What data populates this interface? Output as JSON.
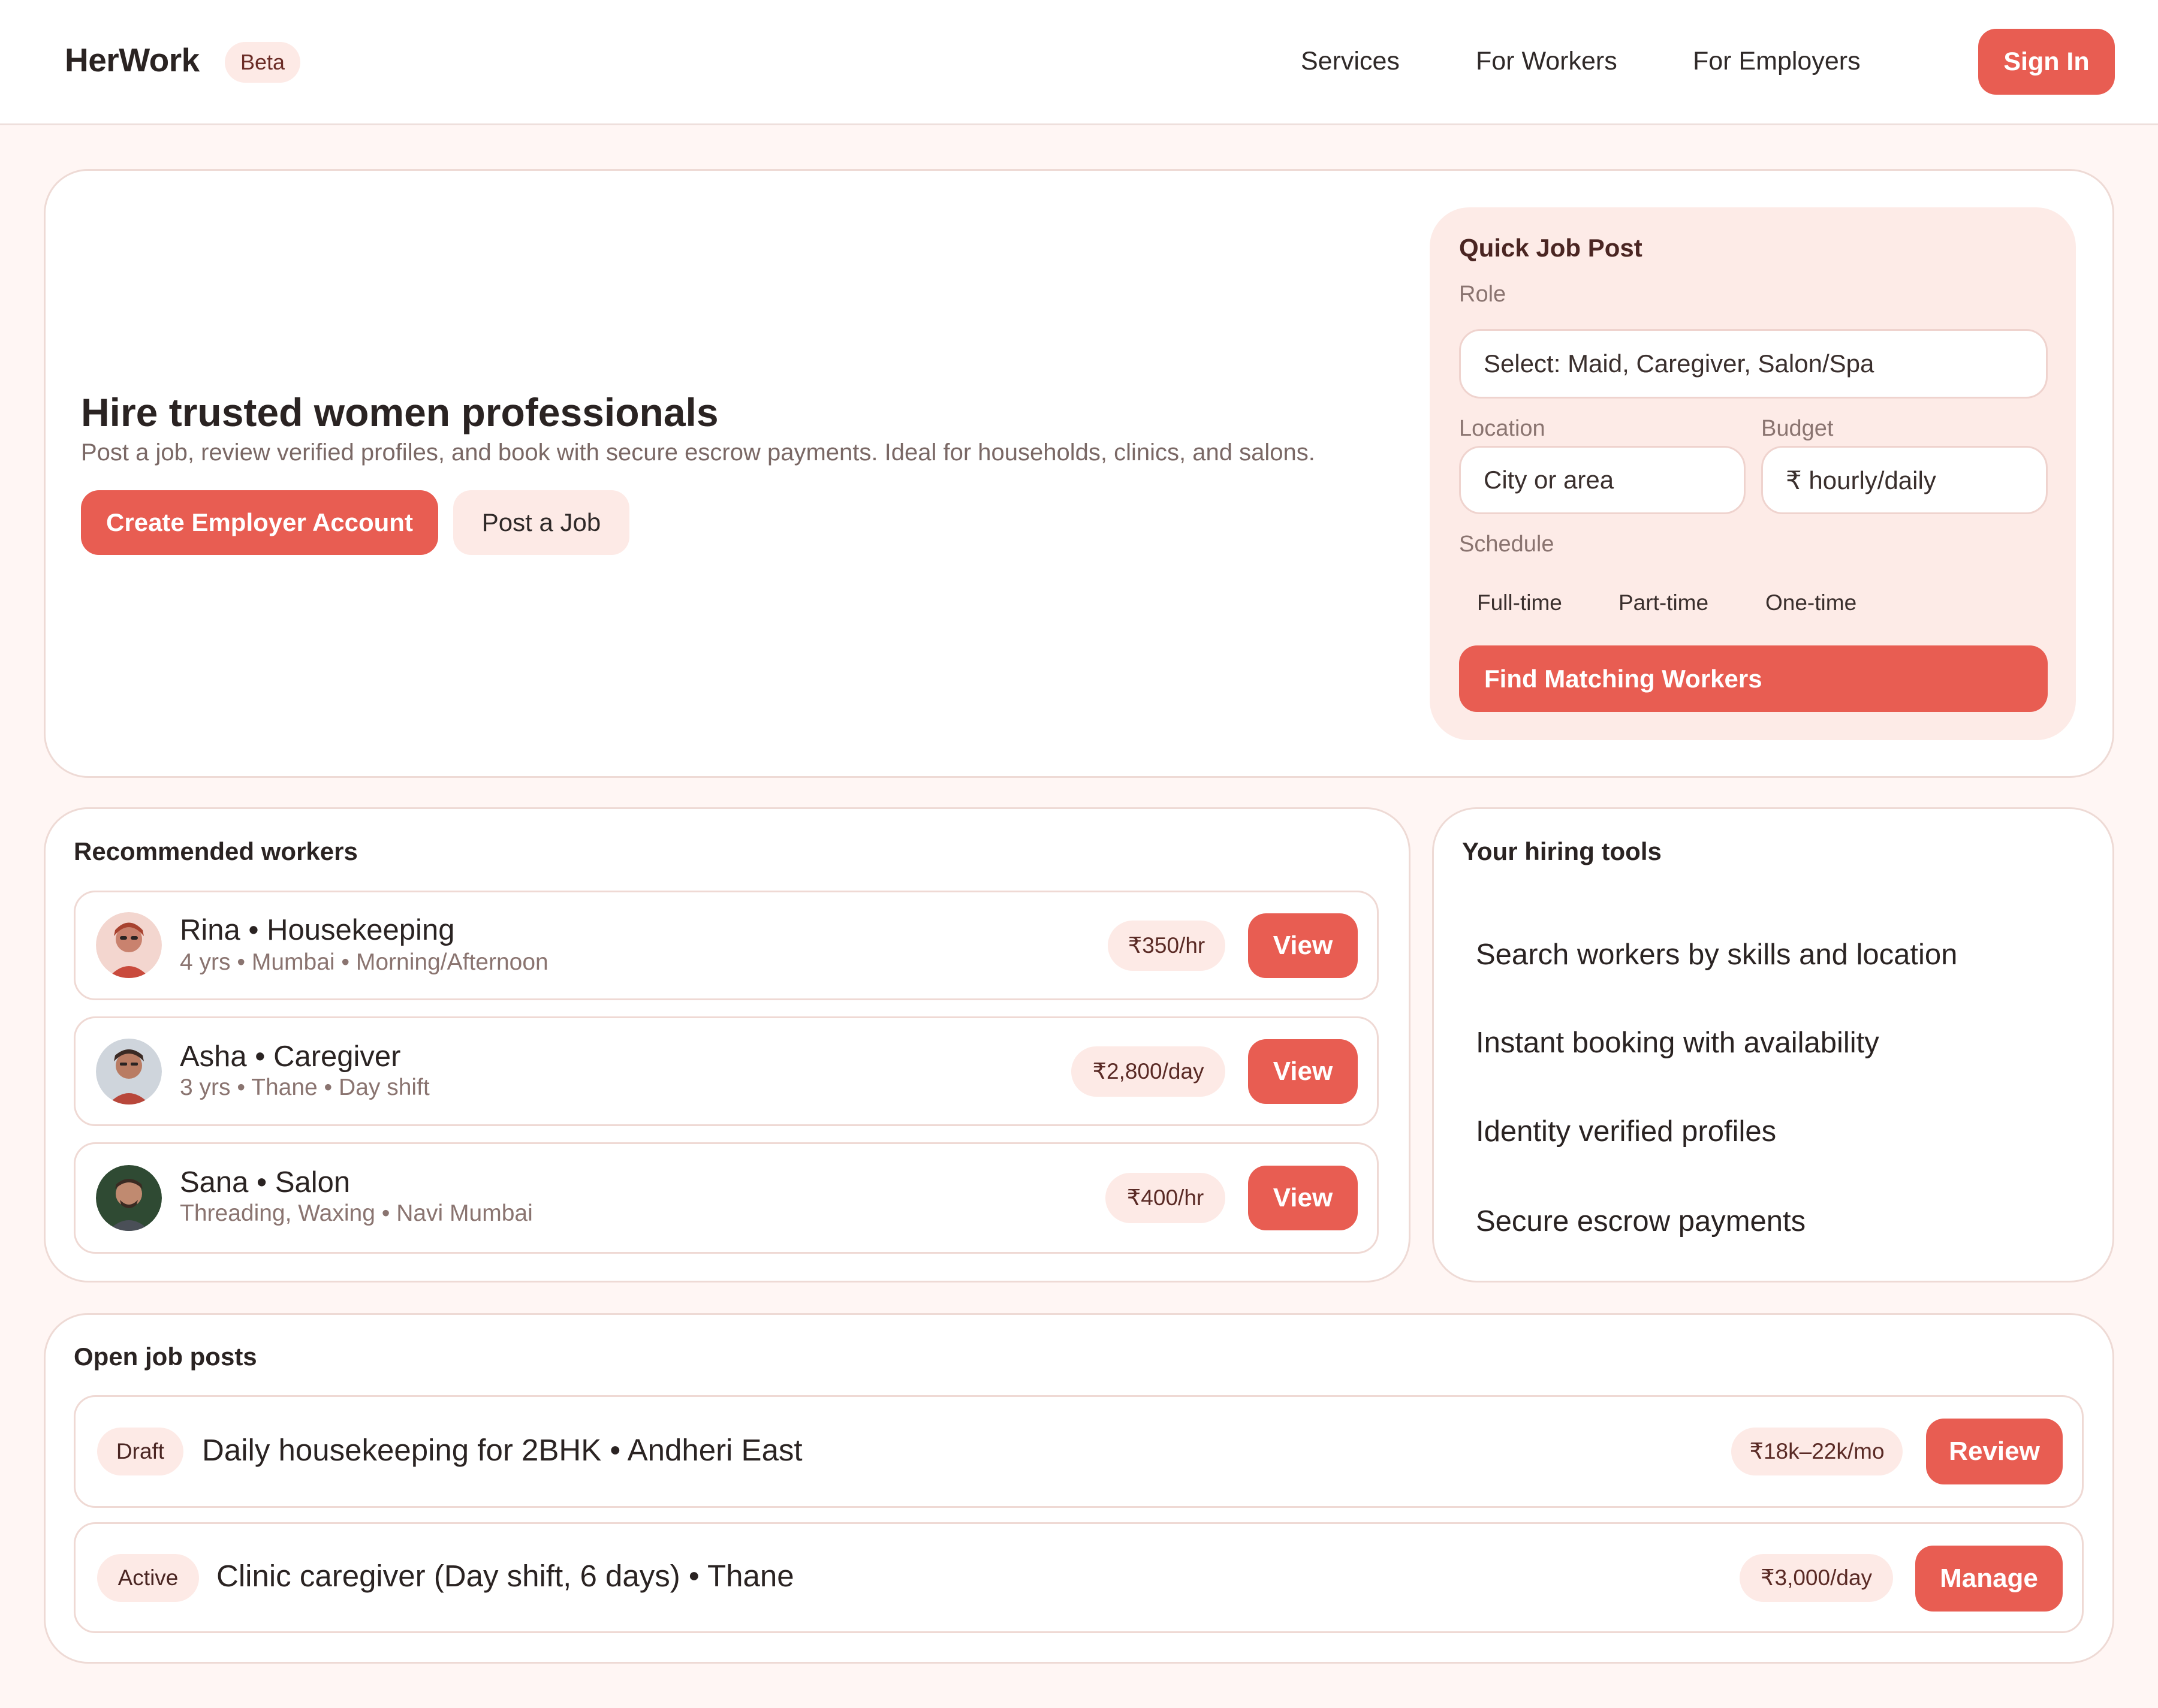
{
  "brand": {
    "name": "HerWork",
    "badge": "Beta"
  },
  "nav": {
    "services": "Services",
    "for_workers": "For Workers",
    "for_employers": "For Employers",
    "sign_in": "Sign In"
  },
  "hero": {
    "title": "Hire trusted women professionals",
    "subtitle": "Post a job, review verified profiles, and book with secure escrow payments. Ideal for households, clinics, and salons.",
    "primary_cta": "Create Employer Account",
    "secondary_cta": "Post a Job"
  },
  "quick_post": {
    "title": "Quick Job Post",
    "role_label": "Role",
    "role_placeholder": "Select: Maid, Caregiver, Salon/Spa",
    "location_label": "Location",
    "location_placeholder": "City or area",
    "budget_label": "Budget",
    "budget_placeholder": "₹ hourly/daily",
    "schedule_label": "Schedule",
    "schedule_options": [
      "Full-time",
      "Part-time",
      "One-time"
    ],
    "submit": "Find Matching Workers"
  },
  "recommended": {
    "title": "Recommended workers",
    "workers": [
      {
        "name": "Rina • Housekeeping",
        "meta": "4 yrs • Mumbai • Morning/Afternoon",
        "rate": "₹350/hr",
        "action": "View"
      },
      {
        "name": "Asha • Caregiver",
        "meta": "3 yrs • Thane • Day shift",
        "rate": "₹2,800/day",
        "action": "View"
      },
      {
        "name": "Sana • Salon",
        "meta": "Threading, Waxing • Navi Mumbai",
        "rate": "₹400/hr",
        "action": "View"
      }
    ]
  },
  "tools": {
    "title": "Your hiring tools",
    "items": [
      "Search workers by skills and location",
      "Instant booking with availability",
      "Identity verified profiles",
      "Secure escrow payments"
    ]
  },
  "jobs": {
    "title": "Open job posts",
    "posts": [
      {
        "status": "Draft",
        "title": "Daily housekeeping for 2BHK • Andheri East",
        "pay": "₹18k–22k/mo",
        "action": "Review"
      },
      {
        "status": "Active",
        "title": "Clinic caregiver (Day shift, 6 days) • Thane",
        "pay": "₹3,000/day",
        "action": "Manage"
      }
    ]
  }
}
